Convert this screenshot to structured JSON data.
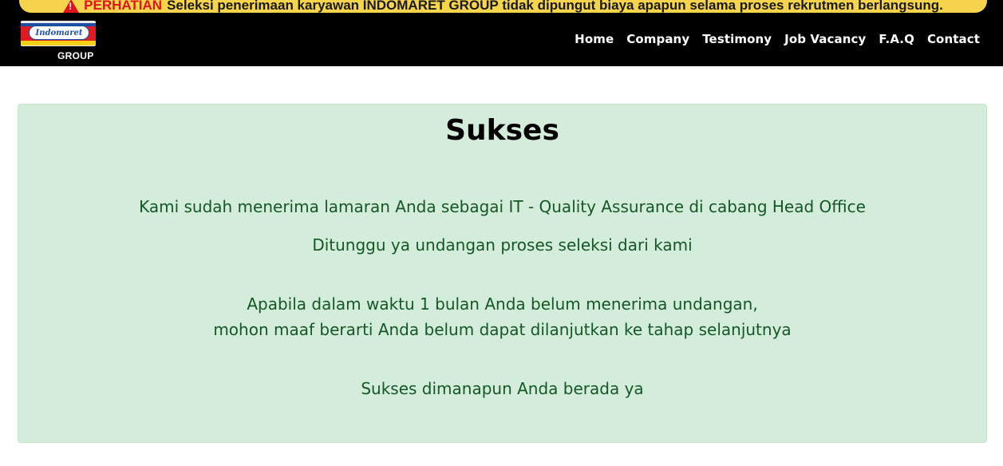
{
  "alert": {
    "keyword": "PERHATIAN",
    "text": "Seleksi penerimaan karyawan INDOMARET GROUP tidak dipungut biaya apapun selama proses rekrutmen berlangsung.",
    "icon": "warning-icon"
  },
  "logo": {
    "brand": "Indomaret",
    "group": "GROUP"
  },
  "nav": {
    "items": [
      "Home",
      "Company",
      "Testimony",
      "Job Vacancy",
      "F.A.Q",
      "Contact"
    ]
  },
  "message": {
    "title": "Sukses",
    "line1": "Kami sudah menerima lamaran Anda sebagai IT - Quality Assurance di cabang Head Office",
    "line2": "Ditunggu ya undangan proses seleksi dari kami",
    "line3": "Apabila dalam waktu 1 bulan Anda belum menerima undangan,",
    "line4": "mohon maaf berarti Anda belum dapat dilanjutkan ke tahap selanjutnya",
    "line5": "Sukses dimanapun Anda berada ya"
  },
  "colors": {
    "header_bg": "#000000",
    "alert_bg": "#f6d44c",
    "alert_keyword": "#e0141e",
    "success_bg": "#d4ecda",
    "success_text": "#155724"
  }
}
